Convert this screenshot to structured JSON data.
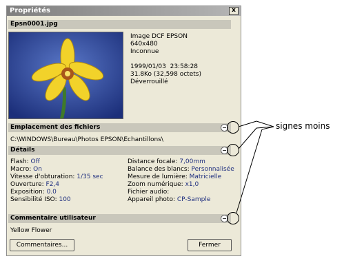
{
  "window": {
    "title": "Propriétés",
    "close_label": "x",
    "filename": "Epsn0001.jpg"
  },
  "info": {
    "lines": [
      "Image DCF EPSON",
      "640x480",
      "Inconnue",
      "",
      "1999/01/03  23:58:28",
      "31.8Ko (32,598 octets)",
      "Déverrouillé"
    ]
  },
  "sections": {
    "location": "Emplacement des fichiers",
    "details": "Détails",
    "comment": "Commentaire utilisateur"
  },
  "path": "C:\\WINDOWS\\Bureau\\Photos EPSON\\Echantillons\\",
  "details_left": [
    {
      "label": "Flash: ",
      "value": "Off"
    },
    {
      "label": "Macro: ",
      "value": "On"
    },
    {
      "label": "Vitesse d'obturation: ",
      "value": "1/35 sec"
    },
    {
      "label": "Ouverture: ",
      "value": "F2,4"
    },
    {
      "label": "Exposition: ",
      "value": "0.0"
    },
    {
      "label": "Sensibilité ISO: ",
      "value": "100"
    }
  ],
  "details_right": [
    {
      "label": "Distance focale: ",
      "value": "7,00mm"
    },
    {
      "label": "Balance des blancs: ",
      "value": "Personnalisée"
    },
    {
      "label": "Mesure de lumière: ",
      "value": "Matricielle"
    },
    {
      "label": "Zoom numérique: ",
      "value": "x1,0"
    },
    {
      "label": "Fichier audio: ",
      "value": ""
    },
    {
      "label": "Appareil photo: ",
      "value": "CP-Sample"
    }
  ],
  "comment_text": "Yellow Flower",
  "buttons": {
    "comments": "Commentaires...",
    "close": "Fermer"
  },
  "callout": "signes moins",
  "icons": [
    "close-icon",
    "minus-icon",
    "flower-photo"
  ]
}
